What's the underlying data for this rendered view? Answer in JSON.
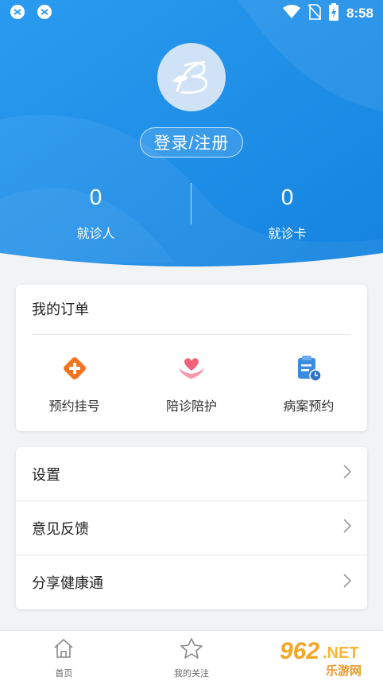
{
  "status_bar": {
    "time": "8:58"
  },
  "header": {
    "login_label": "登录/注册",
    "stats": [
      {
        "value": "0",
        "label": "就诊人"
      },
      {
        "value": "0",
        "label": "就诊卡"
      }
    ]
  },
  "orders": {
    "title": "我的订单",
    "items": [
      {
        "label": "预约挂号",
        "icon": "plus-diamond-icon",
        "color": "#f07422"
      },
      {
        "label": "陪诊陪护",
        "icon": "heart-hands-icon",
        "color": "#f0617a"
      },
      {
        "label": "病案预约",
        "icon": "clipboard-clock-icon",
        "color": "#3b8be0"
      }
    ]
  },
  "menu": {
    "items": [
      {
        "label": "设置"
      },
      {
        "label": "意见反馈"
      },
      {
        "label": "分享健康通"
      }
    ]
  },
  "tabbar": {
    "tabs": [
      {
        "label": "首页",
        "icon": "home-icon"
      },
      {
        "label": "我的关注",
        "icon": "star-icon"
      }
    ]
  },
  "watermark": {
    "brand": "962",
    "suffix": ".NET",
    "cn": "乐游网"
  },
  "colors": {
    "primary": "#1a8de8",
    "primary_light": "#4aa9f0",
    "background": "#f2f3f5"
  }
}
